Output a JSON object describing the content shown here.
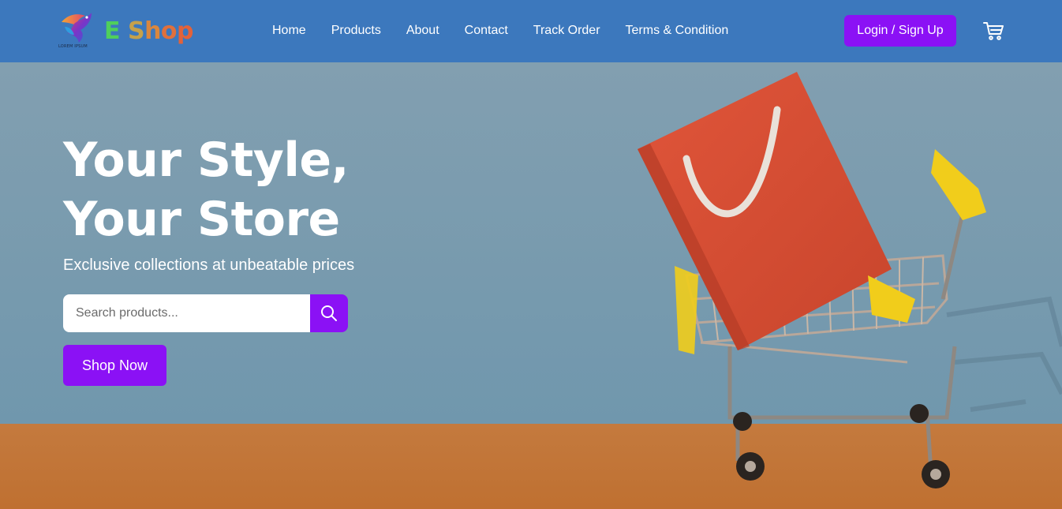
{
  "brand": {
    "letters": [
      "E",
      " ",
      "S",
      "h",
      "o",
      "p"
    ],
    "logo_sub": "LOREM IPSUM"
  },
  "nav": {
    "links": [
      "Home",
      "Products",
      "About",
      "Contact",
      "Track Order",
      "Terms & Condition"
    ],
    "login_label": "Login / Sign Up"
  },
  "hero": {
    "title_line1": "Your Style,",
    "title_line2": "Your Store",
    "subtitle": "Exclusive collections at unbeatable prices",
    "search_placeholder": "Search products...",
    "shop_label": "Shop Now"
  },
  "icons": {
    "logo": "bird-logo-icon",
    "cart": "cart-icon",
    "search": "search-icon"
  },
  "colors": {
    "navbar": "#3c78bd",
    "accent": "#8b11f5",
    "floor": "#c77a3c",
    "wall": "#7e9fb3"
  }
}
